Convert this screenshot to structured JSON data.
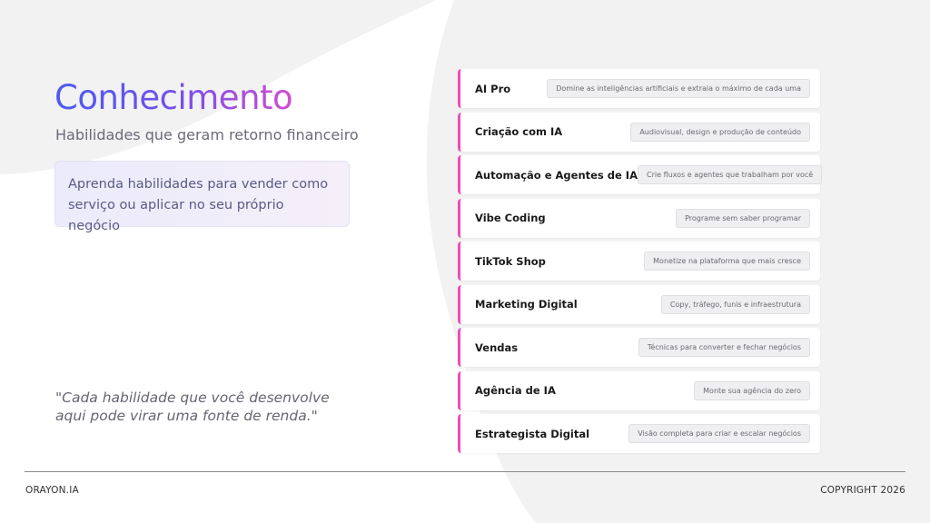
{
  "header": {
    "title": "Conhecimento",
    "subtitle": "Habilidades que geram retorno financeiro"
  },
  "callout": {
    "text": "Aprenda habilidades para vender como serviço ou aplicar no seu próprio negócio"
  },
  "quote": {
    "text": "\"Cada habilidade que você desenvolve aqui pode virar uma fonte de renda.\""
  },
  "skills": [
    {
      "name": "AI Pro",
      "description": "Domine as inteligências artificiais e extraia o máximo de cada uma"
    },
    {
      "name": "Criação com IA",
      "description": "Audiovisual, design e produção de conteúdo"
    },
    {
      "name": "Automação e Agentes de IA",
      "description": "Crie fluxos e agentes que trabalham por você"
    },
    {
      "name": "Vibe Coding",
      "description": "Programe sem saber programar"
    },
    {
      "name": "TikTok Shop",
      "description": "Monetize na plataforma que mais cresce"
    },
    {
      "name": "Marketing Digital",
      "description": "Copy, tráfego, funis e infraestrutura"
    },
    {
      "name": "Vendas",
      "description": "Técnicas para converter e fechar negócios"
    },
    {
      "name": "Agência de IA",
      "description": "Monte sua agência do zero"
    },
    {
      "name": "Estrategista Digital",
      "description": "Visão completa para criar e escalar negócios"
    }
  ],
  "footer": {
    "brand": "ORAYON.IA",
    "copyright": "COPYRIGHT 2026"
  },
  "colors": {
    "accent_bar": "#ec4fb6",
    "title_gradient_start": "#4a5cf0",
    "title_gradient_end": "#d04fd0",
    "background": "#f2f2f3"
  }
}
